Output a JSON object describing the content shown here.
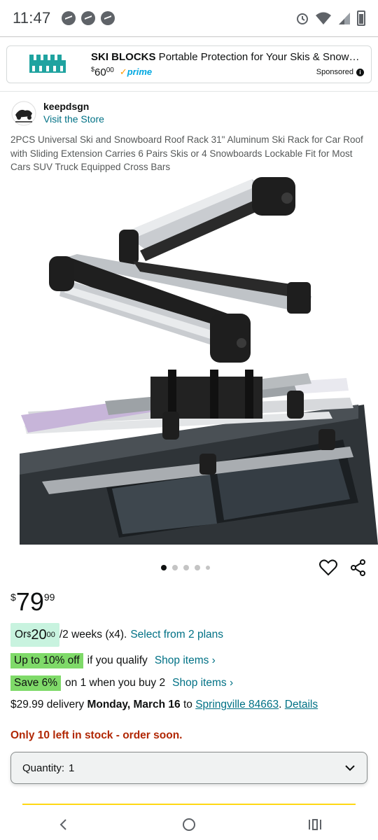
{
  "status_bar": {
    "time": "11:47",
    "left_icons": [
      "messenger-icon",
      "messenger-icon",
      "messenger-icon"
    ],
    "right_icons": [
      "alarm-icon",
      "wifi-icon",
      "signal-icon",
      "battery-icon"
    ]
  },
  "ad": {
    "brand": "SKI BLOCKS",
    "title_rest": " Portable Protection for Your Skis & Snowboards...",
    "price_symbol": "$",
    "price_whole": "60",
    "price_cents": "00",
    "prime_label": "prime",
    "sponsored_label": "Sponsored",
    "logo_color": "#1fa3a0"
  },
  "store": {
    "name": "keepdsgn",
    "link": "Visit the Store"
  },
  "product": {
    "title": "2PCS Universal Ski and Snowboard Roof Rack 31\" Aluminum Ski Rack for Car Roof with Sliding Extension Carries 6 Pairs Skis or 4 Snowboards Lockable Fit for Most Cars SUV Truck Equipped Cross Bars",
    "image_count": 5,
    "active_image": 0
  },
  "price": {
    "currency": "$",
    "whole": "79",
    "cents": "99"
  },
  "installment": {
    "prefix": "Or ",
    "currency": "$",
    "whole": "20",
    "cents": "00",
    "suffix": "/2 weeks (x4).",
    "link": "Select from 2 plans"
  },
  "promo1": {
    "badge": "Up to 10% off",
    "text": "if you qualify",
    "link": "Shop items ›"
  },
  "promo2": {
    "badge": "Save 6%",
    "text": "on 1 when you buy 2",
    "link": "Shop items ›"
  },
  "delivery": {
    "prefix": "$29.99 delivery ",
    "date": "Monday, March 16",
    "to": " to ",
    "location": "Springville 84663",
    "period": ". ",
    "details": "Details"
  },
  "stock_text": "Only 10 left in stock - order soon.",
  "quantity": {
    "label": "Quantity:",
    "value": "1"
  },
  "colors": {
    "link": "#007185",
    "stock": "#b12704",
    "badge_green": "#7fda69",
    "installment_bg": "#c8f3df",
    "prime": "#00a8e1"
  }
}
